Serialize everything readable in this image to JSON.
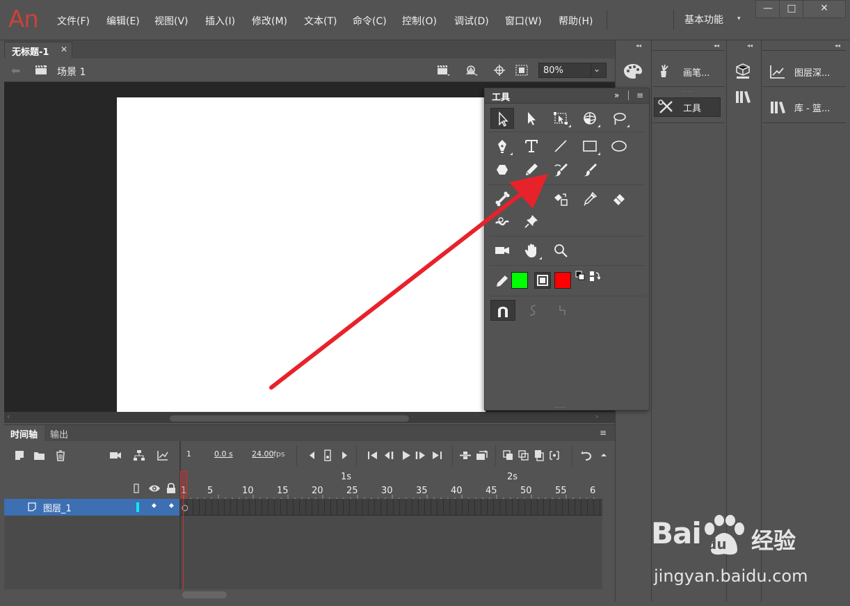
{
  "app": {
    "logo_text": "An"
  },
  "menu": {
    "items": [
      "文件(F)",
      "编辑(E)",
      "视图(V)",
      "插入(I)",
      "修改(M)",
      "文本(T)",
      "命令(C)",
      "控制(O)",
      "调试(D)",
      "窗口(W)",
      "帮助(H)"
    ],
    "workspace_label": "基本功能",
    "workspace_arrow": "▾"
  },
  "window_controls": {
    "minimize": "—",
    "maximize": "□",
    "close": "✕"
  },
  "document": {
    "tab_title": "无标题-1",
    "tab_close": "✕"
  },
  "editbar": {
    "scene_label": "场景 1",
    "zoom_value": "80%",
    "back_arrow": "⬅"
  },
  "timeline": {
    "tab_timeline": "时间轴",
    "tab_output": "输出",
    "panel_menu": "≡",
    "current_frame": "1",
    "elapsed_time": "0.0 s",
    "frame_rate": "24.00",
    "fps_unit": "fps",
    "ruler_numbers": [
      "1",
      "5",
      "10",
      "15",
      "20",
      "25",
      "30",
      "35",
      "40",
      "45",
      "50",
      "55",
      "6"
    ],
    "ruler_seconds": [
      "1s",
      "2s"
    ],
    "layer_name": "图层_1"
  },
  "tools_panel": {
    "title": "工具",
    "collapse_icon": "»",
    "menu_icon": "≡",
    "stroke_color": "#00ff00",
    "fill_color": "#ff0000",
    "active_tool": "selection-tool"
  },
  "dock": {
    "panel_brushes": "画笔...",
    "panel_tools": "工具",
    "panel_layer_depth": "图层深...",
    "panel_library": "库 - 篮..."
  },
  "watermark": {
    "brand": "Bai",
    "du": "du",
    "jingyan": "经验",
    "url": "jingyan.baidu.com"
  }
}
